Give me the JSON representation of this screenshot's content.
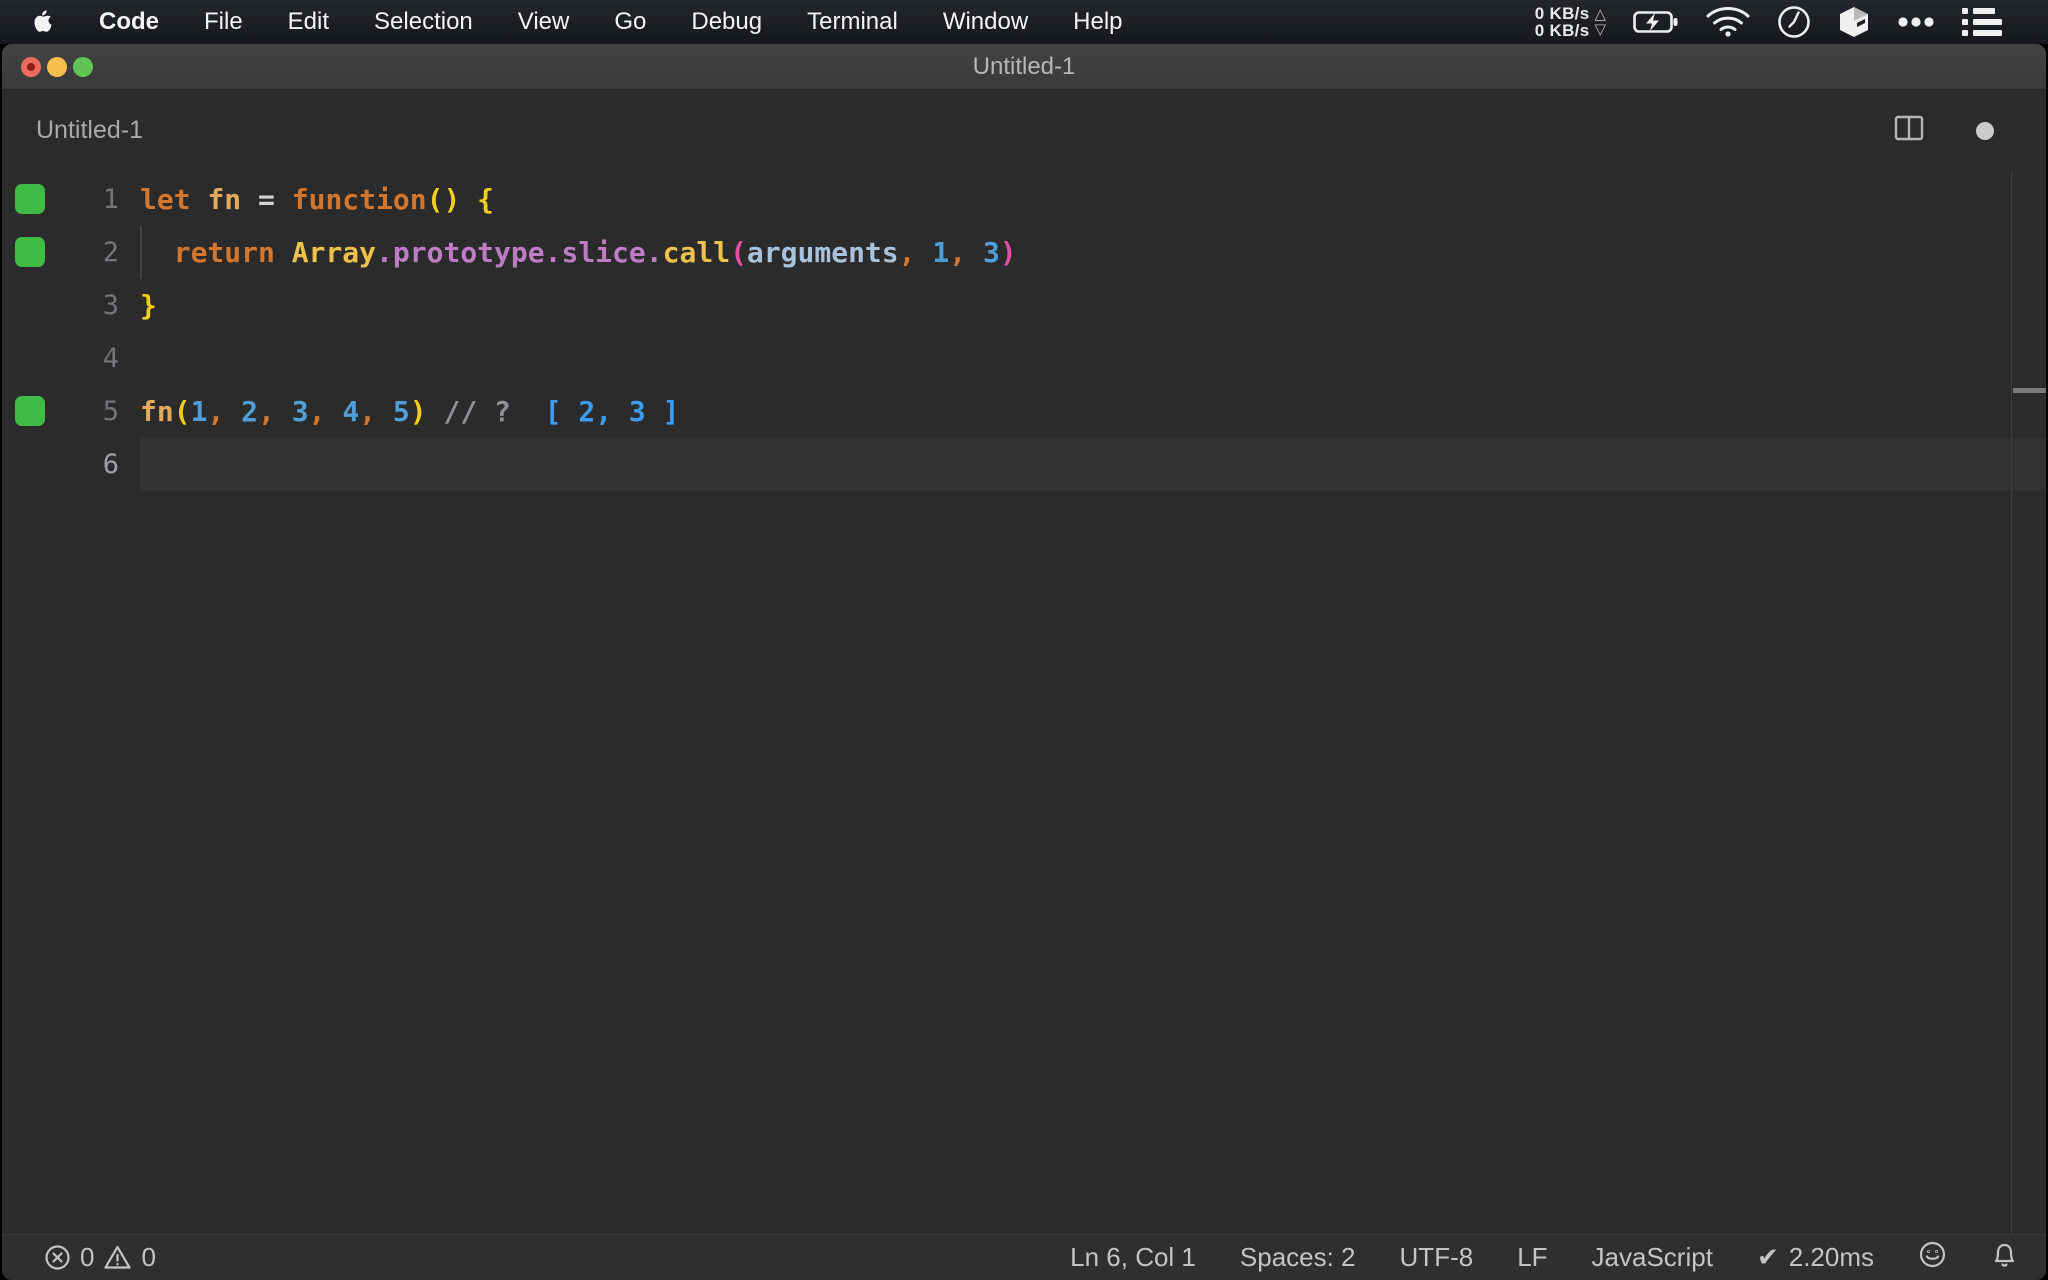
{
  "menu_bar": {
    "items": [
      "Code",
      "File",
      "Edit",
      "Selection",
      "View",
      "Go",
      "Debug",
      "Terminal",
      "Window",
      "Help"
    ],
    "network": {
      "up": "0 KB/s",
      "down": "0 KB/s",
      "up_icon": "△",
      "down_icon": "▽"
    }
  },
  "window": {
    "title": "Untitled-1",
    "header_label": "Untitled-1"
  },
  "editor": {
    "background": "#2b2b2b",
    "gutter_mark_color": "#3fbb46",
    "colors": {
      "keyword": "#d4772e",
      "variable": "#e3aa5e",
      "operator": "#d4d4d4",
      "plain": "#d4d4d4",
      "bracket1": "#f3ce1d",
      "builtin": "#edc14b",
      "property": "#bd7cc4",
      "bracket2": "#e3509f",
      "special": "#a7c3dc",
      "number": "#4fa0d8",
      "comma": "#d4772e",
      "comment": "#8e9297",
      "quokka_value": "#3c9cf2"
    },
    "lines": [
      {
        "num": "1",
        "mark": true,
        "tokens": [
          {
            "t": "let",
            "c": "keyword"
          },
          {
            "t": " ",
            "c": "plain"
          },
          {
            "t": "fn",
            "c": "variable"
          },
          {
            "t": " ",
            "c": "plain"
          },
          {
            "t": "=",
            "c": "operator"
          },
          {
            "t": " ",
            "c": "plain"
          },
          {
            "t": "function",
            "c": "keyword"
          },
          {
            "t": "()",
            "c": "bracket1"
          },
          {
            "t": " ",
            "c": "plain"
          },
          {
            "t": "{",
            "c": "bracket1"
          }
        ]
      },
      {
        "num": "2",
        "mark": true,
        "indent_guide": true,
        "tokens": [
          {
            "t": "  ",
            "c": "plain"
          },
          {
            "t": "return",
            "c": "keyword"
          },
          {
            "t": " ",
            "c": "plain"
          },
          {
            "t": "Array",
            "c": "builtin"
          },
          {
            "t": ".",
            "c": "property"
          },
          {
            "t": "prototype",
            "c": "property"
          },
          {
            "t": ".",
            "c": "property"
          },
          {
            "t": "slice",
            "c": "property"
          },
          {
            "t": ".",
            "c": "property"
          },
          {
            "t": "call",
            "c": "builtin"
          },
          {
            "t": "(",
            "c": "bracket2"
          },
          {
            "t": "arguments",
            "c": "special"
          },
          {
            "t": ",",
            "c": "comma"
          },
          {
            "t": " ",
            "c": "plain"
          },
          {
            "t": "1",
            "c": "number"
          },
          {
            "t": ",",
            "c": "comma"
          },
          {
            "t": " ",
            "c": "plain"
          },
          {
            "t": "3",
            "c": "number"
          },
          {
            "t": ")",
            "c": "bracket2"
          }
        ]
      },
      {
        "num": "3",
        "tokens": [
          {
            "t": "}",
            "c": "bracket1"
          }
        ]
      },
      {
        "num": "4",
        "tokens": []
      },
      {
        "num": "5",
        "mark": true,
        "tokens": [
          {
            "t": "fn",
            "c": "variable"
          },
          {
            "t": "(",
            "c": "bracket1"
          },
          {
            "t": "1",
            "c": "number"
          },
          {
            "t": ",",
            "c": "comma"
          },
          {
            "t": " ",
            "c": "plain"
          },
          {
            "t": "2",
            "c": "number"
          },
          {
            "t": ",",
            "c": "comma"
          },
          {
            "t": " ",
            "c": "plain"
          },
          {
            "t": "3",
            "c": "number"
          },
          {
            "t": ",",
            "c": "comma"
          },
          {
            "t": " ",
            "c": "plain"
          },
          {
            "t": "4",
            "c": "number"
          },
          {
            "t": ",",
            "c": "comma"
          },
          {
            "t": " ",
            "c": "plain"
          },
          {
            "t": "5",
            "c": "number"
          },
          {
            "t": ")",
            "c": "bracket1"
          },
          {
            "t": " ",
            "c": "plain"
          },
          {
            "t": "// ?",
            "c": "comment"
          },
          {
            "t": "  ",
            "c": "plain"
          },
          {
            "t": "[ 2, 3 ]",
            "c": "quokka_value"
          }
        ]
      },
      {
        "num": "6",
        "active": true,
        "tokens": []
      }
    ]
  },
  "status_bar": {
    "errors": "0",
    "warnings": "0",
    "cursor": "Ln 6, Col 1",
    "indentation": "Spaces: 2",
    "encoding": "UTF-8",
    "eol": "LF",
    "language": "JavaScript",
    "perf_check": "✔",
    "perf_time": "2.20ms"
  },
  "ui_colors": {
    "traffic_red": "#ed6a5f",
    "traffic_yellow": "#f5bf4f",
    "traffic_green": "#61c454",
    "statusbar_bg": "#2f2f2f",
    "titlebar_bg": "#3d3d3d",
    "menubar_bg": "#191c20"
  }
}
